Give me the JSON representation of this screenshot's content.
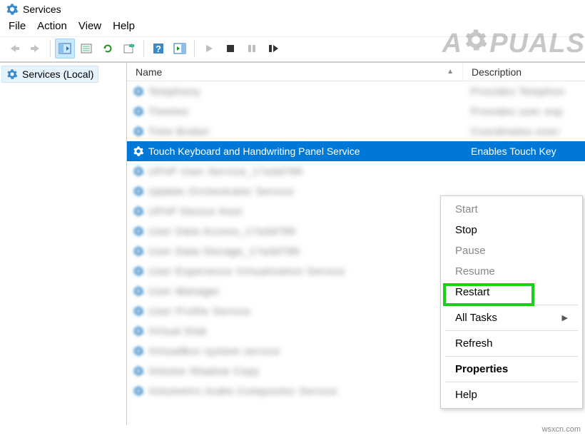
{
  "window": {
    "title": "Services"
  },
  "menu": {
    "file": "File",
    "action": "Action",
    "view": "View",
    "help": "Help"
  },
  "toolbar": {
    "back": "back",
    "forward": "forward",
    "show_hide_tree": "show-hide-tree",
    "properties": "properties",
    "refresh": "refresh",
    "export": "export",
    "help": "help",
    "tasks": "tasks",
    "start": "start",
    "stop": "stop",
    "pause": "pause",
    "restart": "restart"
  },
  "tree": {
    "root": "Services (Local)"
  },
  "list": {
    "columns": {
      "name": "Name",
      "description": "Description"
    },
    "selected_index": 3,
    "rows": [
      {
        "name": "Telephony",
        "description": "Provides Telephon"
      },
      {
        "name": "Themes",
        "description": "Provides user exp"
      },
      {
        "name": "Time Broker",
        "description": "Coordinates exec"
      },
      {
        "name": "Touch Keyboard and Handwriting Panel Service",
        "description": "Enables Touch Key"
      },
      {
        "name": "UPnP User Service_17a3d789",
        "description": ""
      },
      {
        "name": "Update Orchestrator Service",
        "description": ""
      },
      {
        "name": "UPnP Device Host",
        "description": ""
      },
      {
        "name": "User Data Access_17a3d789",
        "description": ""
      },
      {
        "name": "User Data Storage_17a3d789",
        "description": ""
      },
      {
        "name": "User Experience Virtualization Service",
        "description": ""
      },
      {
        "name": "User Manager",
        "description": ""
      },
      {
        "name": "User Profile Service",
        "description": ""
      },
      {
        "name": "Virtual Disk",
        "description": ""
      },
      {
        "name": "VirtualBox system service",
        "description": ""
      },
      {
        "name": "Volume Shadow Copy",
        "description": ""
      },
      {
        "name": "Volumetric Audio Compositor Service",
        "description": ""
      }
    ]
  },
  "context_menu": {
    "start": "Start",
    "stop": "Stop",
    "pause": "Pause",
    "resume": "Resume",
    "restart": "Restart",
    "all_tasks": "All Tasks",
    "refresh": "Refresh",
    "properties": "Properties",
    "help": "Help"
  },
  "watermark": {
    "text_left": "A",
    "text_right": "PUALS"
  },
  "credit": "wsxcn.com"
}
